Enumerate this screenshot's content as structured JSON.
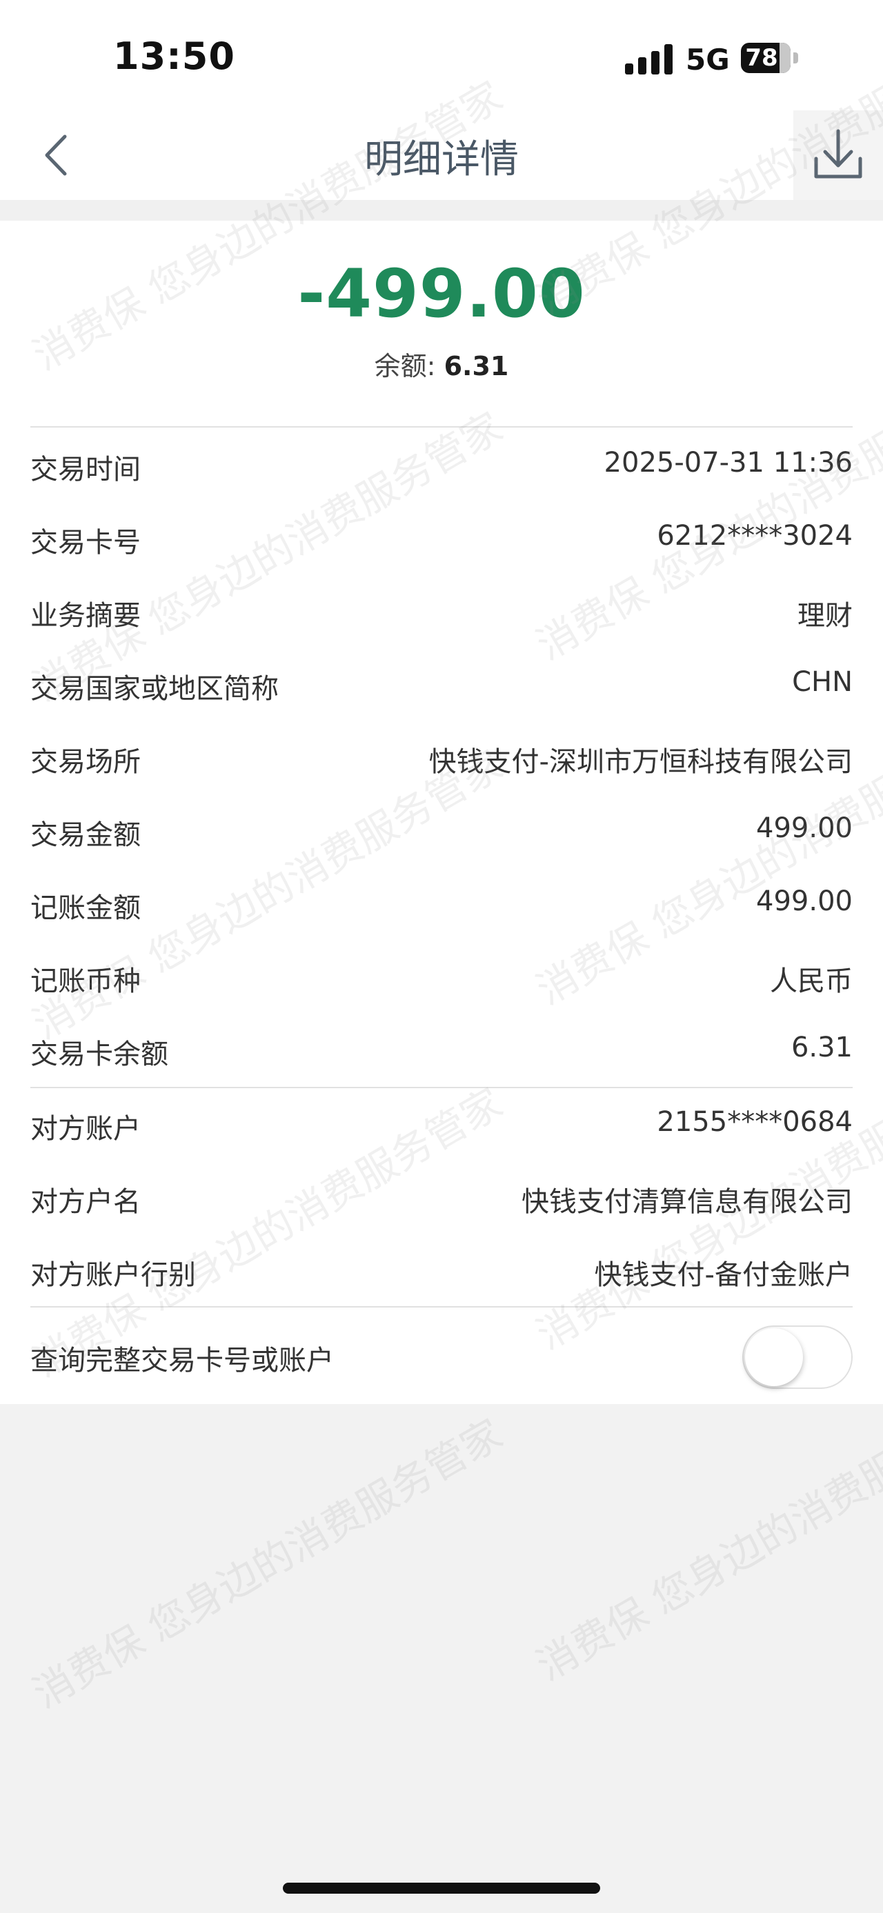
{
  "status_bar": {
    "time": "13:50",
    "network": "5G",
    "battery": "78",
    "battery_level_percent": 78
  },
  "nav": {
    "title": "明细详情",
    "back_icon": "chevron-left-icon",
    "download_icon": "download-icon"
  },
  "summary": {
    "amount": "-499.00",
    "balance_label": "余额:",
    "balance_value": "6.31"
  },
  "details": [
    {
      "label": "交易时间",
      "value": "2025-07-31 11:36"
    },
    {
      "label": "交易卡号",
      "value": "6212****3024"
    },
    {
      "label": "业务摘要",
      "value": "理财"
    },
    {
      "label": "交易国家或地区简称",
      "value": "CHN"
    },
    {
      "label": "交易场所",
      "value": "快钱支付-深圳市万恒科技有限公司"
    },
    {
      "label": "交易金额",
      "value": "499.00"
    },
    {
      "label": "记账金额",
      "value": "499.00"
    },
    {
      "label": "记账币种",
      "value": "人民币"
    },
    {
      "label": "交易卡余额",
      "value": "6.31"
    }
  ],
  "counterparty": [
    {
      "label": "对方账户",
      "value": "2155****0684"
    },
    {
      "label": "对方户名",
      "value": "快钱支付清算信息有限公司"
    },
    {
      "label": "对方账户行别",
      "value": "快钱支付-备付金账户"
    }
  ],
  "query_full": {
    "label": "查询完整交易卡号或账户",
    "enabled": false
  },
  "watermark": {
    "text_a": "消费保 您身边的",
    "text_b": "消费服务管家"
  },
  "colors": {
    "amount": "#1f8a5a",
    "title": "#4a5866",
    "background": "#f2f2f2"
  }
}
